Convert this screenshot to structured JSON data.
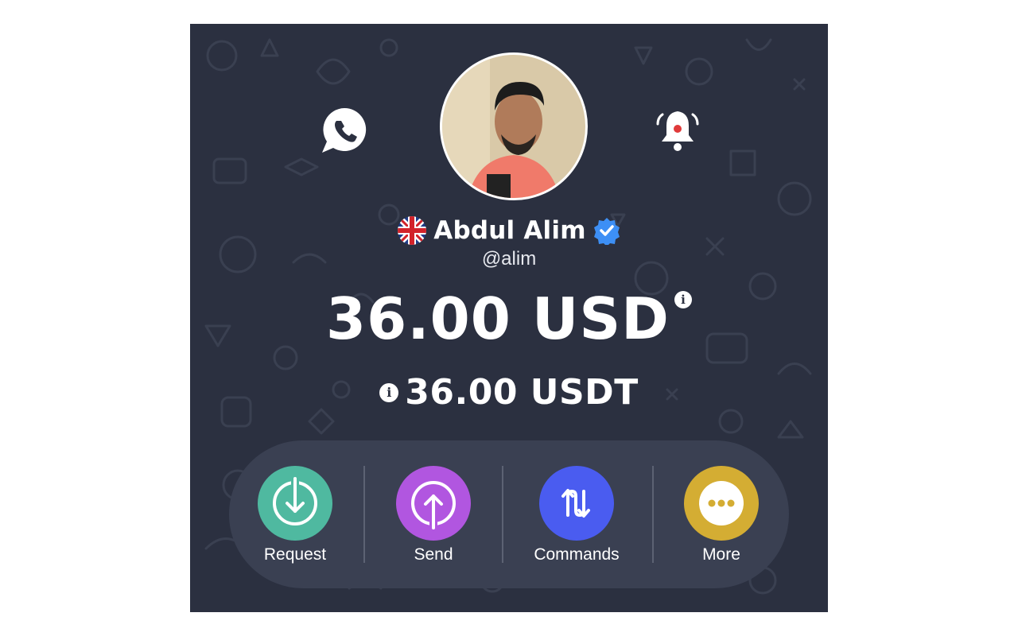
{
  "profile": {
    "name": "Abdul Alim",
    "handle": "@alim",
    "flag_icon": "uk-flag-icon",
    "verified_icon": "verified-badge-icon"
  },
  "balance": {
    "primary": "36.00 USD",
    "secondary": "36.00 USDT",
    "info_glyph": "i"
  },
  "top_icons": {
    "left": "whatsapp-icon",
    "right": "bell-alert-icon"
  },
  "actions": [
    {
      "label": "Request",
      "icon": "download-circle-icon",
      "color": "#4fb9a0"
    },
    {
      "label": "Send",
      "icon": "upload-circle-icon",
      "color": "#b156e0"
    },
    {
      "label": "Commands",
      "icon": "swap-arrows-icon",
      "color": "#4a5cf0"
    },
    {
      "label": "More",
      "icon": "more-dots-icon",
      "color": "#d4ad33"
    }
  ],
  "colors": {
    "panel_bg": "#2b3040",
    "action_bar_bg": "#3a4052",
    "verified_blue": "#3d8ff5"
  }
}
